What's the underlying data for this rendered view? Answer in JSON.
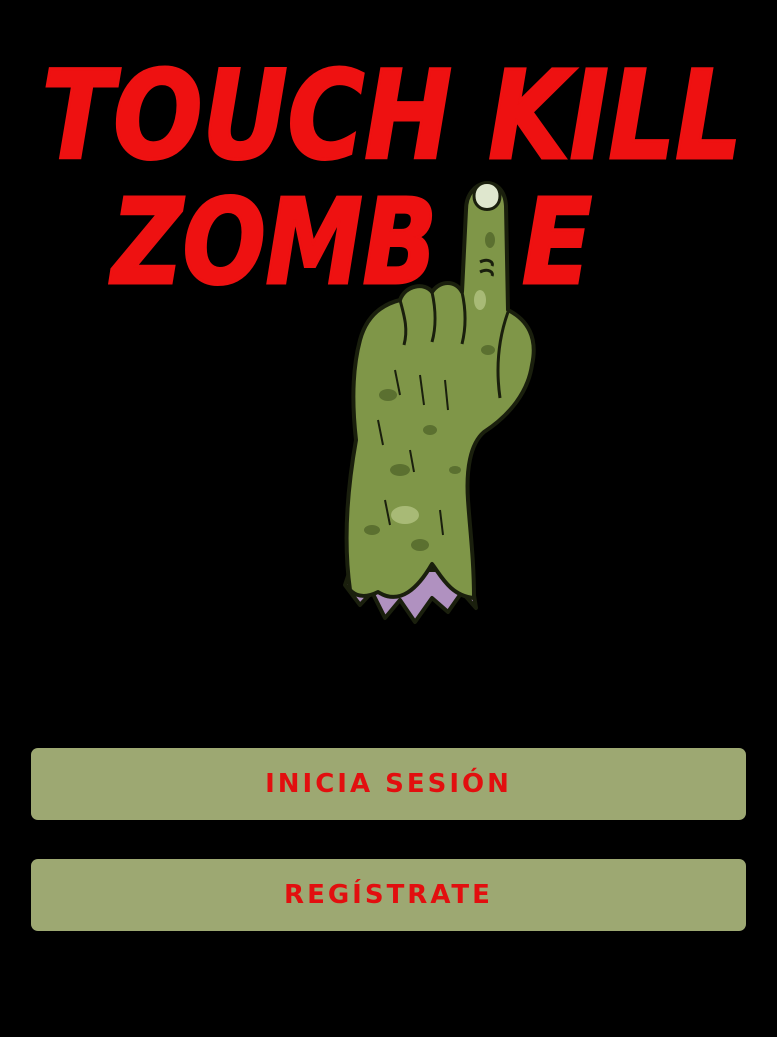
{
  "logo": {
    "line1": "TOUCH KILL",
    "line2": "ZOMB",
    "line2_end": "E"
  },
  "buttons": {
    "login": "INICIA SESIÓN",
    "register": "REGÍSTRATE"
  },
  "colors": {
    "background": "#000000",
    "title": "#ee1111",
    "button_bg": "#9da872",
    "button_text": "#e20f0f",
    "zombie_skin": "#7f9648",
    "zombie_flesh": "#b091c0"
  },
  "icons": {
    "logo_finger": "zombie-finger-icon"
  }
}
